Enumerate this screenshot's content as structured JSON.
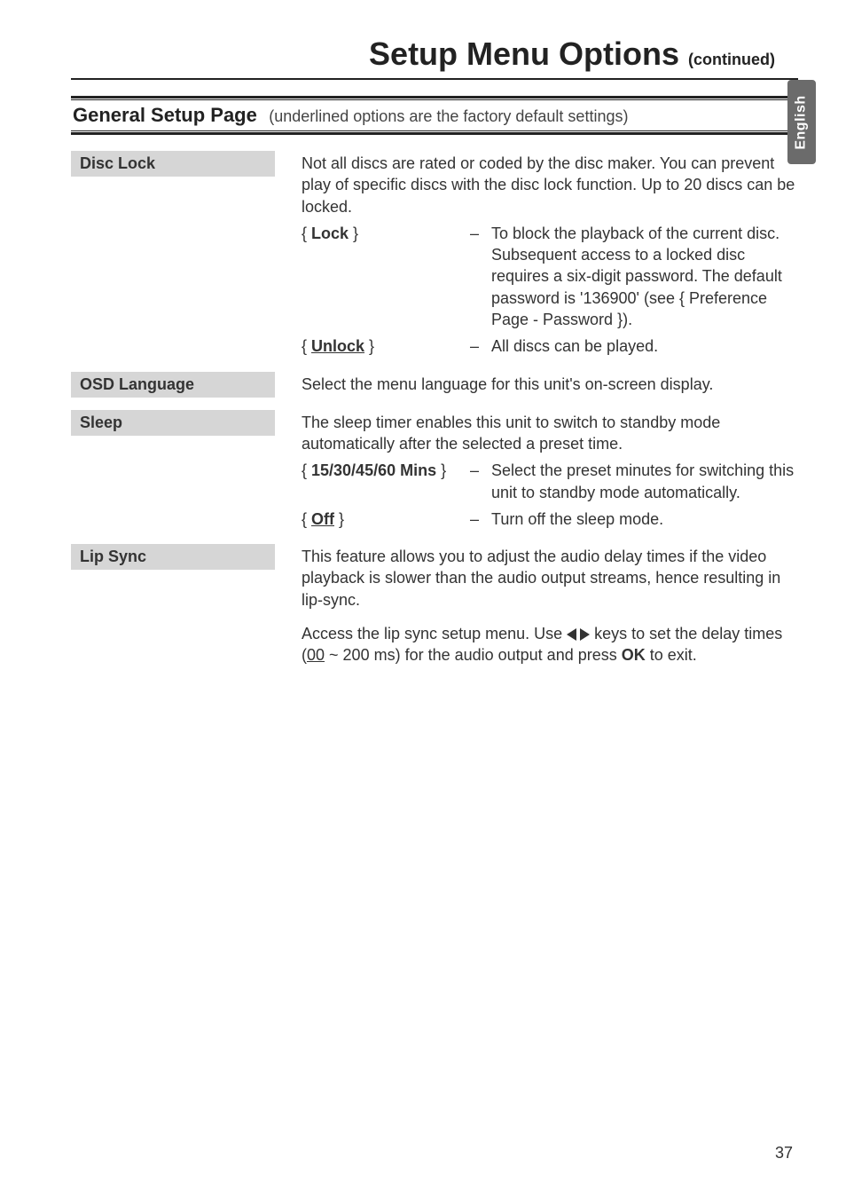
{
  "side_tab": "English",
  "title": {
    "main": "Setup Menu Options",
    "sub": "(continued)"
  },
  "section": {
    "name": "General Setup Page",
    "note": "(underlined options are the factory default settings)"
  },
  "disc_lock": {
    "label": "Disc Lock",
    "intro": "Not all discs are rated or coded by the disc maker. You can prevent play of specific discs with the disc lock function. Up to 20 discs can be locked.",
    "opt1_key": "Lock",
    "opt1_val": "To block the playback of the current disc. Subsequent access to a locked disc requires a six-digit password. The default password is '136900' (see { Preference Page - Password }).",
    "opt2_key": "Unlock",
    "opt2_val": "All discs can be played."
  },
  "osd_language": {
    "label": "OSD Language",
    "intro": "Select the menu language for this unit's on-screen display."
  },
  "sleep": {
    "label": "Sleep",
    "intro": "The sleep timer enables this unit to switch to standby mode automatically after the selected a preset time.",
    "opt1_key": "15/30/45/60 Mins",
    "opt1_val": "Select the preset minutes for switching this unit to standby mode automatically.",
    "opt2_key": "Off",
    "opt2_val": "Turn off the sleep mode."
  },
  "lip_sync": {
    "label": "Lip Sync",
    "intro": "This feature allows you to adjust the audio delay times if the video playback is slower than the audio output streams, hence resulting in lip-sync.",
    "detail_pre": "Access the lip sync setup menu. Use ",
    "detail_mid": " keys to set the delay times (",
    "detail_range_default": "00",
    "detail_range_rest": " ~ 200 ms) for the audio output and press ",
    "detail_ok": "OK",
    "detail_post": " to exit."
  },
  "dash": "–",
  "page_number": "37"
}
